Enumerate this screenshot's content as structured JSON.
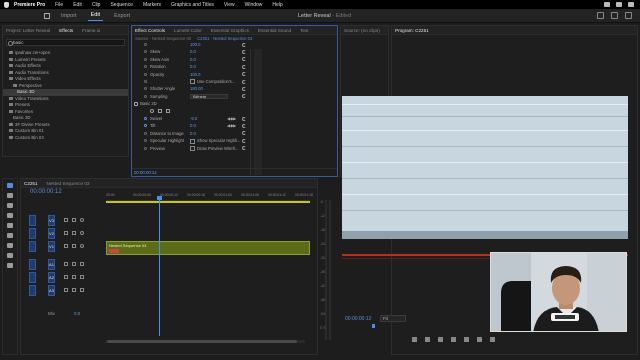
{
  "menubar": {
    "app": "Premiere Pro",
    "items": [
      "File",
      "Edit",
      "Clip",
      "Sequence",
      "Markers",
      "Graphics and Titles",
      "View",
      "Window",
      "Help"
    ]
  },
  "appbar": {
    "nav": [
      "Import",
      "Edit",
      "Export"
    ],
    "active_nav": "Edit",
    "title": "Letter Reveal",
    "title_state": "- Edited"
  },
  "left_panel": {
    "tabs": [
      "Project: Letter Reveal",
      "Effects",
      "Frame.io"
    ],
    "active_tab": "Effects",
    "search": "basic",
    "tree": [
      {
        "label": "ipadnaw cw+open",
        "type": "fold",
        "indent": 1
      },
      {
        "label": "Lumetri Presets",
        "type": "fold",
        "indent": 1
      },
      {
        "label": "Audio Effects",
        "type": "fold",
        "indent": 1
      },
      {
        "label": "Audio Transitions",
        "type": "fold",
        "indent": 1
      },
      {
        "label": "Video Effects",
        "type": "fold",
        "indent": 1
      },
      {
        "label": "Perspective",
        "type": "fold",
        "indent": 2
      },
      {
        "label": "Basic 3D",
        "type": "item",
        "indent": 3,
        "selected": true
      },
      {
        "label": "Video Transitions",
        "type": "fold",
        "indent": 1
      },
      {
        "label": "Presets",
        "type": "fold",
        "indent": 1
      },
      {
        "label": "Favorites",
        "type": "fold",
        "indent": 1
      },
      {
        "label": "Basic 3D",
        "type": "item",
        "indent": 2
      },
      {
        "label": "3F Divine Presets",
        "type": "fold",
        "indent": 1
      },
      {
        "label": "Custom Bin 01",
        "type": "fold",
        "indent": 1
      },
      {
        "label": "Custom Bin 04",
        "type": "fold",
        "indent": 1
      }
    ]
  },
  "effect_controls": {
    "tabs": [
      "Effect Controls",
      "Lumetri Color",
      "Essential Graphics",
      "Essential Sound",
      "Text"
    ],
    "active_tab": "Effect Controls",
    "source_label": "Source · Nested Sequence 03",
    "seq_label": "C2251 · Nested Sequence 03",
    "rows": [
      {
        "label": "",
        "value": "100.0"
      },
      {
        "label": "Skew",
        "value": "0.0"
      },
      {
        "label": "Skew Axis",
        "value": "0.0"
      },
      {
        "label": "Rotation",
        "value": "0.0"
      },
      {
        "label": "Opacity",
        "value": "100.0"
      },
      {
        "label": "",
        "check": "Use Composition's..."
      },
      {
        "label": "Shutter Angle",
        "value": "180.00"
      },
      {
        "label": "Sampling",
        "dropdown": "Bilinear"
      },
      {
        "label": "Basic 3D",
        "fx": true
      },
      {
        "label": "",
        "icons": true
      },
      {
        "label": "Swivel",
        "value": "-9.0",
        "keyframed": true
      },
      {
        "label": "Tilt",
        "value": "0.0",
        "keyframed": true
      },
      {
        "label": "Distance to Image",
        "value": "0.0"
      },
      {
        "label": "Specular Highlight",
        "check": "Show Specular Highli..."
      },
      {
        "label": "Preview",
        "check": "Draw Preview Wirefr..."
      }
    ],
    "timecode": "00:00:00:12"
  },
  "source_panel": {
    "tabs": [
      "Source: (no clips)"
    ]
  },
  "program": {
    "tabs": [
      "Program: C2251"
    ],
    "timecode": "00:00:00:12",
    "fit": "Fit"
  },
  "timeline": {
    "tabs": [
      "C2251",
      "Nested Sequence 03"
    ],
    "active_tab": "C2251",
    "timecode": "00:00:00:12",
    "ruler": [
      "00:00",
      "00:00:00:06",
      "00:00:00:12",
      "00:00:00:18",
      "00:00:01:00",
      "00:00:01:06",
      "00:00:01:12",
      "00:00:01:18"
    ],
    "tracks": [
      {
        "id": "V3",
        "type": "video"
      },
      {
        "id": "V2",
        "type": "video"
      },
      {
        "id": "V1",
        "type": "video"
      },
      {
        "id": "A1",
        "type": "audio"
      },
      {
        "id": "A2",
        "type": "audio"
      },
      {
        "id": "A3",
        "type": "audio"
      },
      {
        "id": "Mix",
        "type": "mix",
        "value": "0.0"
      }
    ],
    "clip": {
      "label": "Nested Sequence 03",
      "fx_label": "fx"
    },
    "meter_labels": [
      "-6",
      "-12",
      "-18",
      "-24",
      "-30",
      "-36",
      "-42",
      "-48",
      "-54",
      "S S"
    ]
  },
  "colors": {
    "accent": "#4a8ef5",
    "clip_green": "#5b6b16",
    "video_bg": "#c8d6e0",
    "record_red": "#c12c1a"
  }
}
